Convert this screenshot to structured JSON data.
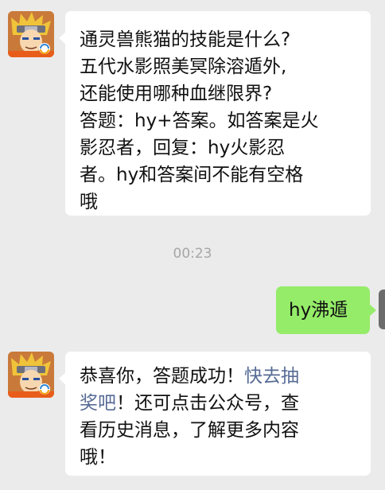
{
  "timestamp": "00:23",
  "colors": {
    "background": "#ebebeb",
    "incoming_bubble": "#ffffff",
    "outgoing_bubble": "#95ec69",
    "link": "#576b95",
    "timestamp": "#a6a6a6"
  },
  "messages": [
    {
      "sender": "official-account",
      "avatar_icon": "ninja-avatar-icon",
      "lines": [
        "通灵兽熊猫的技能是什么?",
        "五代水影照美冥除溶遁外,",
        "还能使用哪种血继限界?",
        "答题：hy+答案。如答案是火",
        "影忍者，回复：hy火影忍",
        "者。hy和答案间不能有空格",
        "哦"
      ]
    },
    {
      "sender": "user",
      "text": "hy沸遁"
    },
    {
      "sender": "official-account",
      "avatar_icon": "ninja-avatar-icon",
      "line1_text": "恭喜你，答题成功！",
      "line1_link": "快去抽",
      "line2_link": "奖吧",
      "line2_text": "！还可点击公众号，查",
      "line3": "看历史消息，了解更多内容",
      "line4": "哦！"
    }
  ]
}
